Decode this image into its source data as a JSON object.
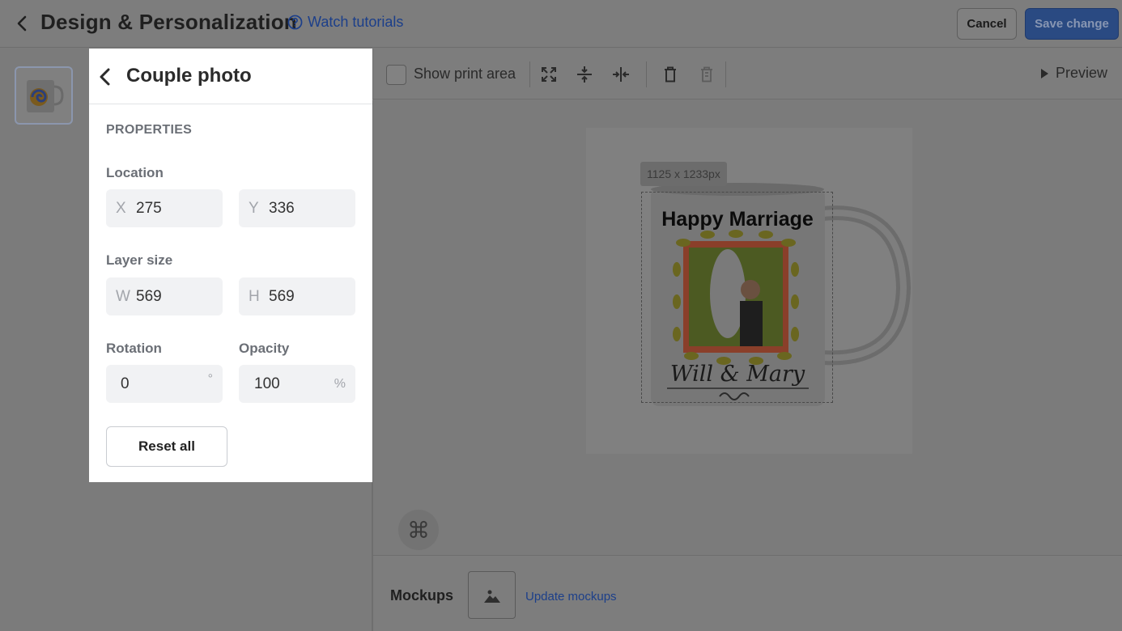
{
  "header": {
    "title": "Design & Personalization",
    "tutorials_label": "Watch tutorials",
    "cancel_label": "Cancel",
    "save_label": "Save change"
  },
  "panel": {
    "title": "Couple photo",
    "section": "PROPERTIES",
    "location_label": "Location",
    "x_prefix": "X",
    "x_value": "275",
    "y_prefix": "Y",
    "y_value": "336",
    "layer_size_label": "Layer size",
    "w_prefix": "W",
    "w_value": "569",
    "h_prefix": "H",
    "h_value": "569",
    "rotation_label": "Rotation",
    "rotation_value": "0",
    "rotation_unit": "°",
    "opacity_label": "Opacity",
    "opacity_value": "100",
    "opacity_unit": "%",
    "reset_label": "Reset all"
  },
  "toolbar": {
    "show_print_area_label": "Show print area",
    "show_print_area_checked": false,
    "preview_label": "Preview"
  },
  "canvas": {
    "size_tag": "1125 x 1233px",
    "design_title": "Happy Marriage",
    "design_names": "Will & Mary"
  },
  "mockups": {
    "label": "Mockups",
    "update_label": "Update mockups"
  },
  "colors": {
    "accent_blue": "#2a4a82",
    "link_blue": "#1c3f8a",
    "overlay_gray": "#7b7b7b",
    "panel_bg": "#ffffff"
  }
}
